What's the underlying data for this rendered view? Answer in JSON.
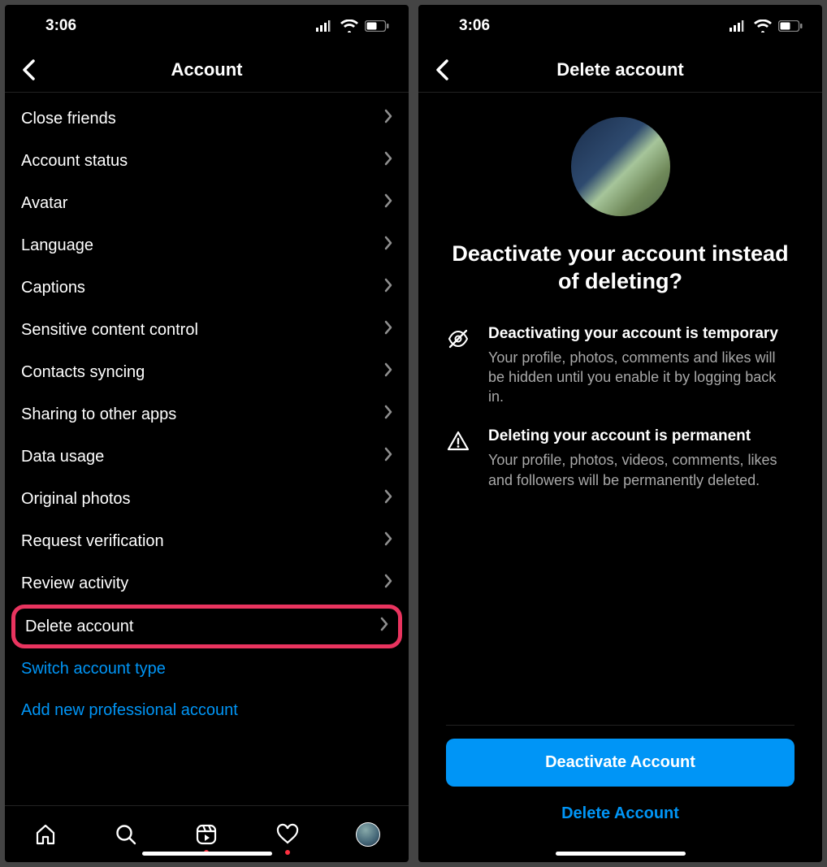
{
  "status": {
    "time": "3:06"
  },
  "left": {
    "title": "Account",
    "rows": [
      "Close friends",
      "Account status",
      "Avatar",
      "Language",
      "Captions",
      "Sensitive content control",
      "Contacts syncing",
      "Sharing to other apps",
      "Data usage",
      "Original photos",
      "Request verification",
      "Review activity",
      "Delete account"
    ],
    "highlighted_index": 12,
    "links": [
      "Switch account type",
      "Add new professional account"
    ],
    "tabs": [
      "home",
      "search",
      "reels",
      "activity",
      "profile"
    ],
    "tabs_with_dot": [
      "reels",
      "activity"
    ]
  },
  "right": {
    "title": "Delete account",
    "heading": "Deactivate your account instead of deleting?",
    "items": [
      {
        "icon": "eye-off-icon",
        "title": "Deactivating your account is temporary",
        "desc": "Your profile, photos, comments and likes will be hidden until you enable it by logging back in."
      },
      {
        "icon": "warning-icon",
        "title": "Deleting your account is permanent",
        "desc": "Your profile, photos, videos, comments, likes and followers will be permanently deleted."
      }
    ],
    "primary_button": "Deactivate Account",
    "secondary_button": "Delete Account"
  }
}
